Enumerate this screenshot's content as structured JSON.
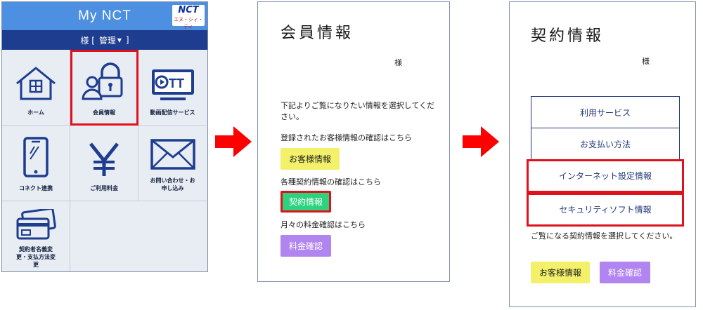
{
  "panel1": {
    "title": "My NCT",
    "logo": {
      "main": "NCT",
      "sub": "エヌ・シィ・ティ"
    },
    "user_suffix": "様 [",
    "manage_label": "管理",
    "manage_caret": "▾",
    "user_close": "]",
    "menu": [
      {
        "label": "ホーム",
        "icon": "house-icon"
      },
      {
        "label": "会員情報",
        "icon": "member-lock-icon"
      },
      {
        "label": "動画配信サービス",
        "icon": "ott-icon"
      },
      {
        "label": "コネクト連携",
        "icon": "smartphone-icon"
      },
      {
        "label": "ご利用料金",
        "icon": "yen-icon"
      },
      {
        "label": "お問い合わせ・お申し込み",
        "icon": "envelope-icon"
      },
      {
        "label": "契約者名義変更・支払方法変更",
        "icon": "credit-cards-icon"
      }
    ]
  },
  "panel2": {
    "heading": "会員情報",
    "honorific": "様",
    "intro": "下記よりご覧になりたい情報を選択してください。",
    "customer_prompt": "登録されたお客様情報の確認はこちら",
    "customer_button": "お客様情報",
    "contract_prompt": "各種契約情報の確認はこちら",
    "contract_button": "契約情報",
    "fee_prompt": "月々の料金確認はこちら",
    "fee_button": "料金確認"
  },
  "panel3": {
    "heading": "契約情報",
    "honorific": "様",
    "services": [
      "利用サービス",
      "お支払い方法",
      "インターネット設定情報",
      "セキュリティソフト情報"
    ],
    "note": "ご覧になる契約情報を選択してください。",
    "customer_button": "お客様情報",
    "fee_button": "料金確認"
  },
  "colors": {
    "header_blue": "#4d8fe0",
    "userbar_navy": "#1e3d8f",
    "highlight_red": "#e0111b",
    "yellow_button": "#f3f06a",
    "green_button": "#2dd27f",
    "purple_button": "#b185f0"
  }
}
